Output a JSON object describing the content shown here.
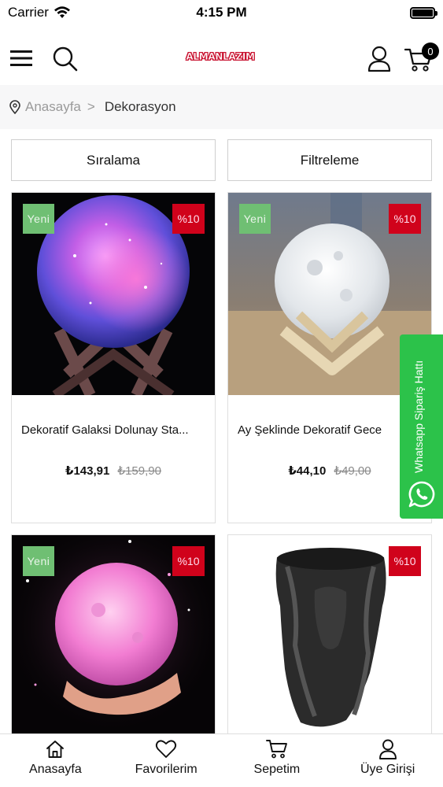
{
  "status_bar": {
    "carrier": "Carrier",
    "time": "4:15 PM",
    "icons": [
      "wifi-icon",
      "battery-icon"
    ]
  },
  "header": {
    "logo_text": "ALMANLAZIM",
    "cart_count": "0",
    "icons": [
      "menu-icon",
      "search-icon",
      "user-icon",
      "cart-icon"
    ]
  },
  "breadcrumb": {
    "home": "Anasayfa",
    "separator": ">",
    "current": "Dekorasyon"
  },
  "controls": {
    "sort_label": "Sıralama",
    "filter_label": "Filtreleme"
  },
  "products": [
    {
      "title": "Dekoratif Galaksi Dolunay Sta...",
      "price": "₺143,91",
      "old_price": "₺159,90",
      "new_badge": "Yeni",
      "discount_badge": "%10"
    },
    {
      "title": "Ay Şeklinde Dekoratif Gece",
      "price": "₺44,10",
      "old_price": "₺49,00",
      "new_badge": "Yeni",
      "discount_badge": "%10"
    },
    {
      "title": "",
      "price": "",
      "old_price": "",
      "new_badge": "Yeni",
      "discount_badge": "%10"
    },
    {
      "title": "",
      "price": "",
      "old_price": "",
      "new_badge": "",
      "discount_badge": "%10"
    }
  ],
  "whatsapp": {
    "label": "Whatsapp Sipariş Hattı"
  },
  "tab_bar": {
    "tabs": [
      {
        "label": "Anasayfa",
        "icon": "home-icon"
      },
      {
        "label": "Favorilerim",
        "icon": "heart-icon"
      },
      {
        "label": "Sepetim",
        "icon": "cart-icon"
      },
      {
        "label": "Üye Girişi",
        "icon": "user-icon"
      }
    ]
  },
  "colors": {
    "badge_new": "#6fbf73",
    "badge_discount": "#d0021b",
    "whatsapp": "#2cc24a",
    "logo": "#c8102e"
  }
}
